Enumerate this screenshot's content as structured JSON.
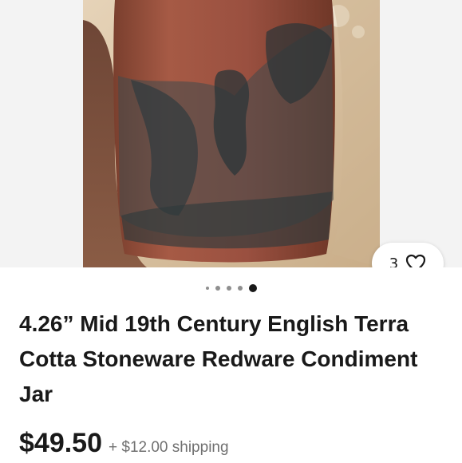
{
  "listing": {
    "watch_count": "3",
    "carousel": {
      "total": 5,
      "active_index": 4
    },
    "title": "4.26” Mid 19th Century English Terra Cotta Stoneware Redware Condiment Jar",
    "price": "$49.50",
    "shipping": "+ $12.00 shipping"
  },
  "icons": {
    "watch": "heart-outline-icon"
  },
  "colors": {
    "text": "#191919",
    "secondary_text": "#707070",
    "active_dot": "#191919",
    "inactive_dot": "#8f8f8f"
  }
}
